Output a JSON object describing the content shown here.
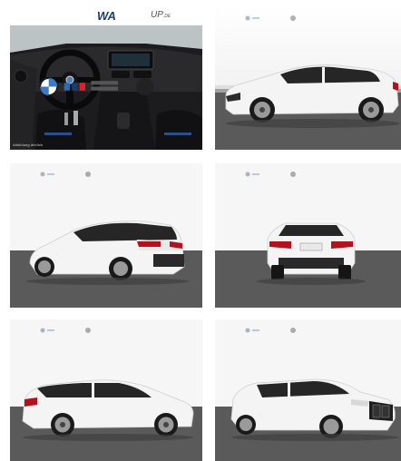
{
  "gallery": {
    "thumbnails": [
      {
        "view": "interior-cockpit"
      },
      {
        "view": "side-right"
      },
      {
        "view": "rear-three-quarter-left"
      },
      {
        "view": "rear"
      },
      {
        "view": "side-left"
      },
      {
        "view": "front-three-quarter-right"
      }
    ],
    "first": {
      "header_brand": "WA",
      "header_suffix": "UP",
      "header_suffix_small": ".DE",
      "caption": "Abbildung ähnlich"
    }
  },
  "colors": {
    "car_body": "#f4f4f4",
    "floor": "#5a5a5a",
    "backdrop": "#ffffff",
    "tail_light": "#b3121c",
    "interior_dark": "#1c1c1e"
  }
}
